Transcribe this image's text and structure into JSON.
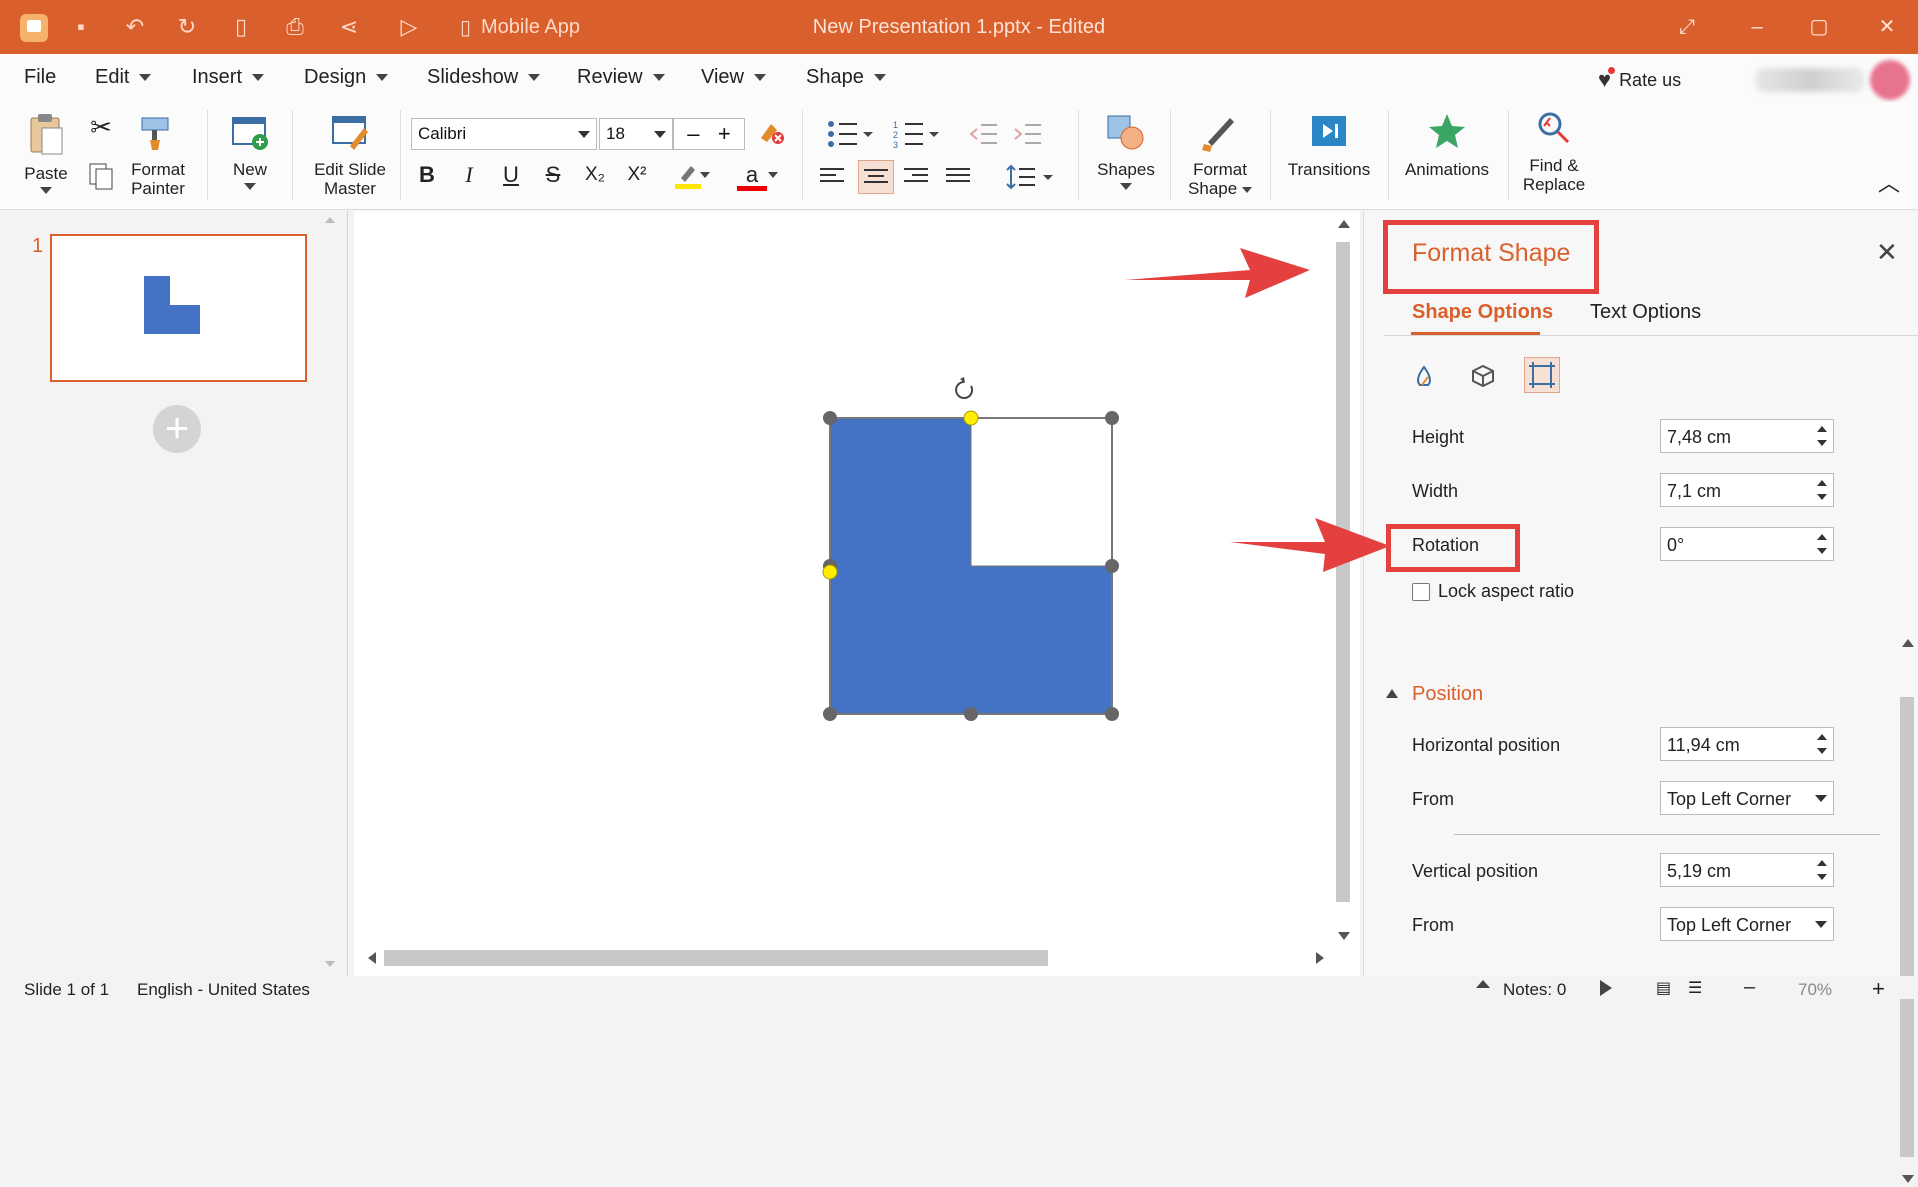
{
  "titlebar": {
    "mobile_app": "Mobile App",
    "doc_title": "New Presentation 1.pptx - Edited"
  },
  "menu": {
    "file": "File",
    "edit": "Edit",
    "insert": "Insert",
    "design": "Design",
    "slideshow": "Slideshow",
    "review": "Review",
    "view": "View",
    "shape": "Shape",
    "rate_us": "Rate us"
  },
  "ribbon": {
    "paste": "Paste",
    "format_painter_1": "Format",
    "format_painter_2": "Painter",
    "new": "New",
    "edit_master_1": "Edit Slide",
    "edit_master_2": "Master",
    "font_name": "Calibri",
    "font_size": "18",
    "shapes": "Shapes",
    "format_shape_1": "Format",
    "format_shape_2": "Shape",
    "transitions": "Transitions",
    "animations": "Animations",
    "find_1": "Find &",
    "find_2": "Replace"
  },
  "slides": {
    "number": "1"
  },
  "format_pane": {
    "title": "Format Shape",
    "tab_shape": "Shape Options",
    "tab_text": "Text Options",
    "height_label": "Height",
    "height_value": "7,48 cm",
    "width_label": "Width",
    "width_value": "7,1 cm",
    "rotation_label": "Rotation",
    "rotation_value": "0°",
    "lock_aspect": "Lock aspect ratio",
    "position_section": "Position",
    "h_pos_label": "Horizontal position",
    "h_pos_value": "11,94 cm",
    "h_from_label": "From",
    "h_from_value": "Top Left Corner",
    "v_pos_label": "Vertical position",
    "v_pos_value": "5,19 cm",
    "v_from_label": "From",
    "v_from_value": "Top Left Corner"
  },
  "status": {
    "slide": "Slide 1 of 1",
    "language": "English - United States",
    "notes": "Notes: 0",
    "zoom": "70%"
  },
  "colors": {
    "accent": "#d9602c",
    "shape_fill": "#4472c4",
    "annotation": "#e54040"
  }
}
